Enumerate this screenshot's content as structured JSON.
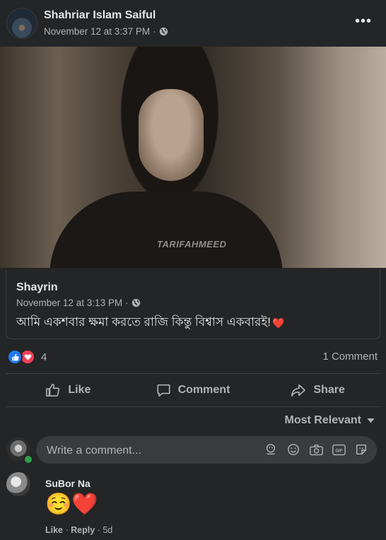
{
  "post": {
    "author": "Shahriar Islam Saiful",
    "timestamp": "November 12 at 3:37 PM",
    "privacy_icon": "globe-icon",
    "more_icon": "more-options-icon"
  },
  "media": {
    "watermark": "TARIFAHMEED"
  },
  "shared_post": {
    "author": "Shayrin",
    "timestamp": "November 12 at 3:13 PM",
    "text": "আমি একশবার ক্ষমা করতে রাজি কিন্তু বিশ্বাস একবারই!",
    "emoji": "❤️"
  },
  "reactions": {
    "count": "4",
    "types": [
      "like",
      "love"
    ],
    "comment_count": "1 Comment"
  },
  "actions": {
    "like": "Like",
    "comment": "Comment",
    "share": "Share"
  },
  "sort": {
    "label": "Most Relevant"
  },
  "comment_input": {
    "placeholder": "Write a comment...",
    "icons": [
      "sticker-avatar-icon",
      "emoji-icon",
      "camera-icon",
      "gif-icon",
      "sticker-icon"
    ]
  },
  "comments": [
    {
      "author": "SuBor Na",
      "emojis": "☺️❤️",
      "like": "Like",
      "reply": "Reply",
      "age": "5d"
    }
  ],
  "colors": {
    "background": "#242526",
    "like_blue": "#2078f4",
    "love_red": "#f33e58",
    "online_green": "#31a24c"
  }
}
